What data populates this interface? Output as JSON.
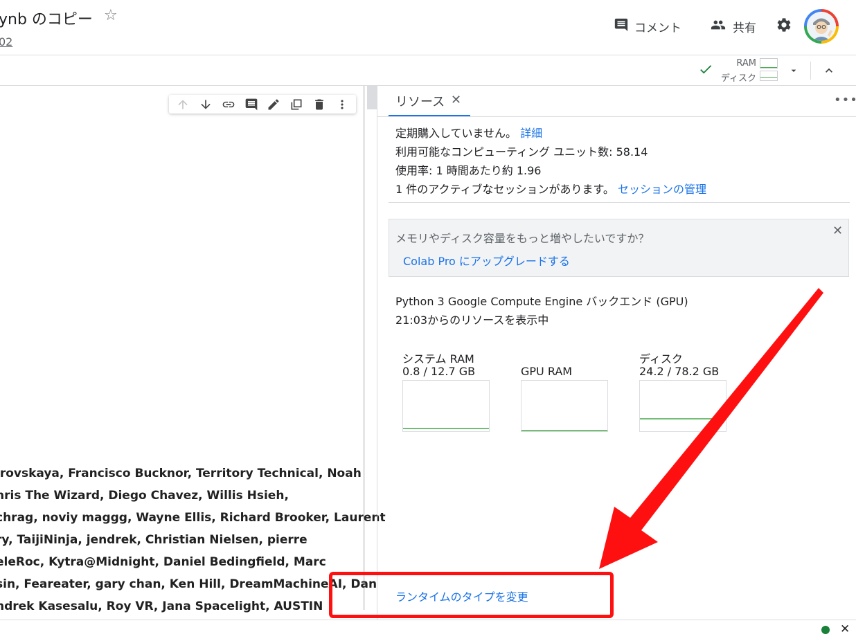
{
  "header": {
    "title": "ynb のコピー",
    "subtitle": "02",
    "comment_label": "コメント",
    "share_label": "共有"
  },
  "resources_indicator": {
    "ram_label": "RAM",
    "disk_label": "ディスク"
  },
  "notebook": {
    "patron_lines": [
      "irovskaya, Francisco Bucknor, Territory Technical, Noah",
      "hris The Wizard, Diego Chavez, Willis Hsieh,",
      "chrag, noviy maggg, Wayne Ellis, Richard Brooker, Laurent",
      "ry, TaijiNinja, jendrek, Christian Nielsen, pierre",
      "eleRoc, Kytra@Midnight, Daniel Bedingfield, Marc",
      "sin, Feareater, gary chan, Ken Hill, DreamMachineAI, Dan",
      "ndrek Kasesalu, Roy VR, Jana Spacelight, AUSTIN"
    ]
  },
  "side_panel": {
    "tab_label": "リソース",
    "subscription_text": "定期購入していません。",
    "subscription_link": "詳細",
    "units_text": "利用可能なコンピューティング ユニット数: 58.14",
    "usage_text": "使用率: 1 時間あたり約 1.96",
    "session_text": "1 件のアクティブなセッションがあります。",
    "session_link": "セッションの管理",
    "upgrade": {
      "question": "メモリやディスク容量をもっと増やしたいですか？",
      "link_text": "Colab Pro にアップグレードする"
    },
    "backend_text": "Python 3 Google Compute Engine バックエンド (GPU)",
    "since_text": "21:03からのリソースを表示中",
    "gauges": [
      {
        "label": "システム RAM",
        "value": "0.8 / 12.7 GB",
        "fraction": 0.063
      },
      {
        "label": "GPU RAM",
        "value": "",
        "fraction": 0.0
      },
      {
        "label": "ディスク",
        "value": "24.2 / 78.2 GB",
        "fraction": 0.31
      }
    ],
    "change_runtime_label": "ランタイムのタイプを変更"
  },
  "colors": {
    "link": "#1a73e8",
    "annotation": "#ff1010",
    "gauge": "#4caf50",
    "status": "#188038"
  }
}
